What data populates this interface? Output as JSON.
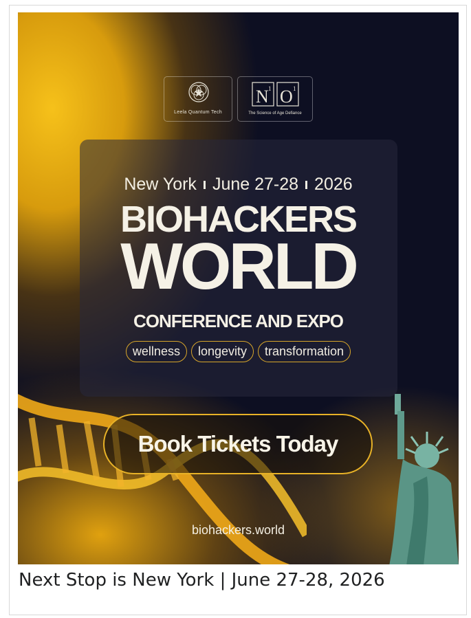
{
  "logos": {
    "leela": "Leela Quantum Tech",
    "no_mark": "N",
    "no_mark_o": "O",
    "no_tagline": "The Science of Age Defiance"
  },
  "event": {
    "city": "New York",
    "dates": "June 27-28",
    "year": "2026",
    "title_line1": "BIOHACKERS",
    "title_line2": "WORLD",
    "title_line3": "CONFERENCE AND EXPO",
    "tags": [
      "wellness",
      "longevity",
      "transformation"
    ],
    "cta": "Book Tickets Today",
    "website": "biohackers.world"
  },
  "caption": "Next Stop is New York | June 27-28, 2026",
  "colors": {
    "accent": "#e8b227",
    "background": "#0d0f22",
    "text": "#f5f1e6"
  }
}
